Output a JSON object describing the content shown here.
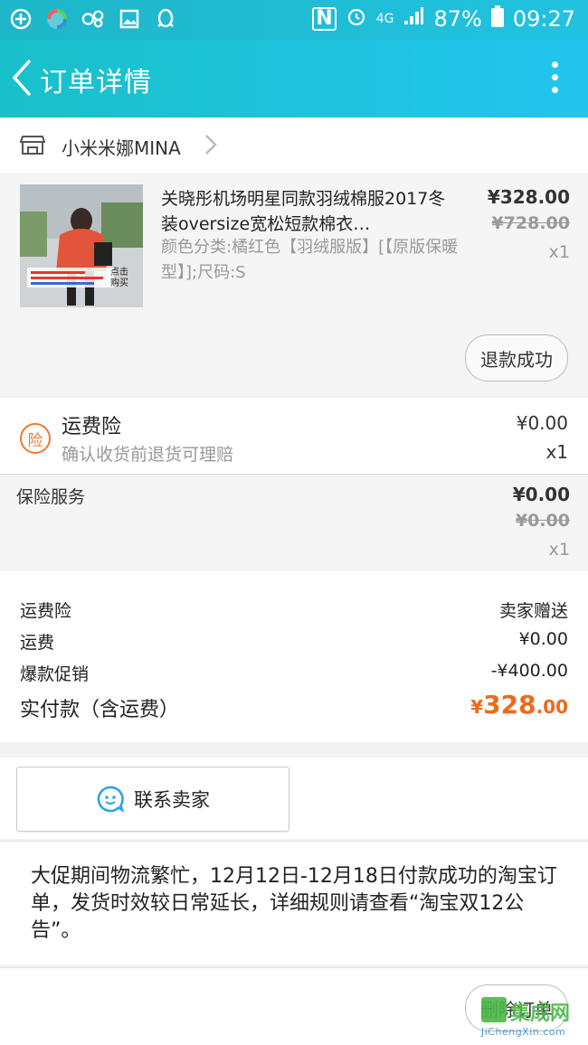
{
  "status_bar": {
    "battery": "87%",
    "time": "09:27",
    "network": "4G"
  },
  "header": {
    "title": "订单详情"
  },
  "shop": {
    "name": "小米米娜MINA"
  },
  "item": {
    "title": "关晓彤机场明星同款羽绒棉服2017冬装oversize宽松短款棉衣…",
    "spec": "颜色分类:橘红色【羽绒服版】[【原版保暖型】];尺码:S",
    "price": "¥328.00",
    "original_price": "¥728.00",
    "quantity": "x1",
    "refund_label": "退款成功",
    "thumb_caption": "点击购买"
  },
  "insurance": {
    "badge": "险",
    "name": "运费险",
    "desc": "确认收货前退货可理赔",
    "price": "¥0.00",
    "quantity": "x1"
  },
  "service": {
    "label": "保险服务",
    "price": "¥0.00",
    "original_price": "¥0.00",
    "quantity": "x1"
  },
  "summary": {
    "rows": [
      {
        "label": "运费险",
        "value": "卖家赠送"
      },
      {
        "label": "运费",
        "value": "¥0.00"
      },
      {
        "label": "爆款促销",
        "value": "-¥400.00"
      }
    ],
    "paid_label": "实付款（含运费）",
    "paid_currency": "¥",
    "paid_int": "328",
    "paid_dec": ".00"
  },
  "contact": {
    "label": "联系卖家"
  },
  "notice": {
    "text": "大促期间物流繁忙，12月12日-12月18日付款成功的淘宝订单，发货时效较日常延长，详细规则请查看“淘宝双12公告”。"
  },
  "actions": {
    "delete_label": "删除订单"
  },
  "watermark": {
    "text": "集成网",
    "sub": "JiChengXin.com"
  },
  "colors": {
    "header_start": "#19c0c8",
    "header_end": "#23c5ef",
    "accent_orange": "#ee6a1a"
  }
}
